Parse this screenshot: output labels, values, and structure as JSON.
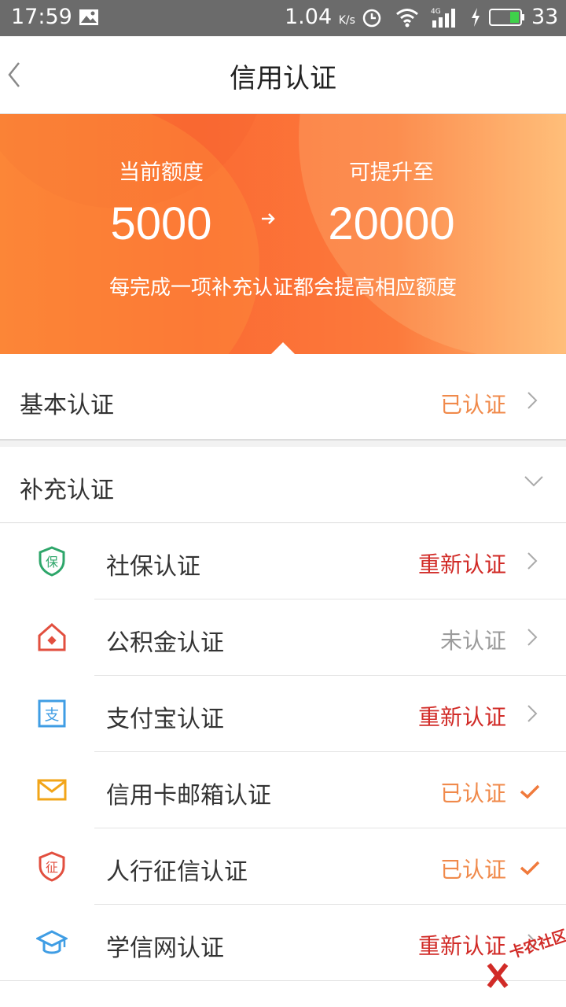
{
  "status_bar": {
    "time": "17:59",
    "speed": "1.04",
    "speed_unit": "K/s",
    "signal_label": "4G",
    "battery": "33"
  },
  "header": {
    "title": "信用认证"
  },
  "hero": {
    "current_label": "当前额度",
    "current_value": "5000",
    "target_label": "可提升至",
    "target_value": "20000",
    "description": "每完成一项补充认证都会提高相应额度"
  },
  "basic": {
    "label": "基本认证",
    "status": "已认证"
  },
  "supplementary": {
    "label": "补充认证",
    "items": [
      {
        "name": "社保认证",
        "status": "重新认证",
        "icon": "social-security-icon",
        "icon_char": "保"
      },
      {
        "name": "公积金认证",
        "status": "未认证",
        "icon": "housing-fund-icon"
      },
      {
        "name": "支付宝认证",
        "status": "重新认证",
        "icon": "alipay-icon",
        "icon_char": "支"
      },
      {
        "name": "信用卡邮箱认证",
        "status": "已认证",
        "icon": "mail-icon"
      },
      {
        "name": "人行征信认证",
        "status": "已认证",
        "icon": "credit-report-icon",
        "icon_char": "征"
      },
      {
        "name": "学信网认证",
        "status": "重新认证",
        "icon": "graduation-cap-icon"
      }
    ]
  },
  "watermark": {
    "text": "卡农社区"
  },
  "colors": {
    "redo": "#d12b27",
    "verified": "#f08a4b",
    "unverified": "#9b9b9b",
    "hero_gradient_start": "#fa7e35",
    "hero_gradient_end": "#ffb872"
  }
}
